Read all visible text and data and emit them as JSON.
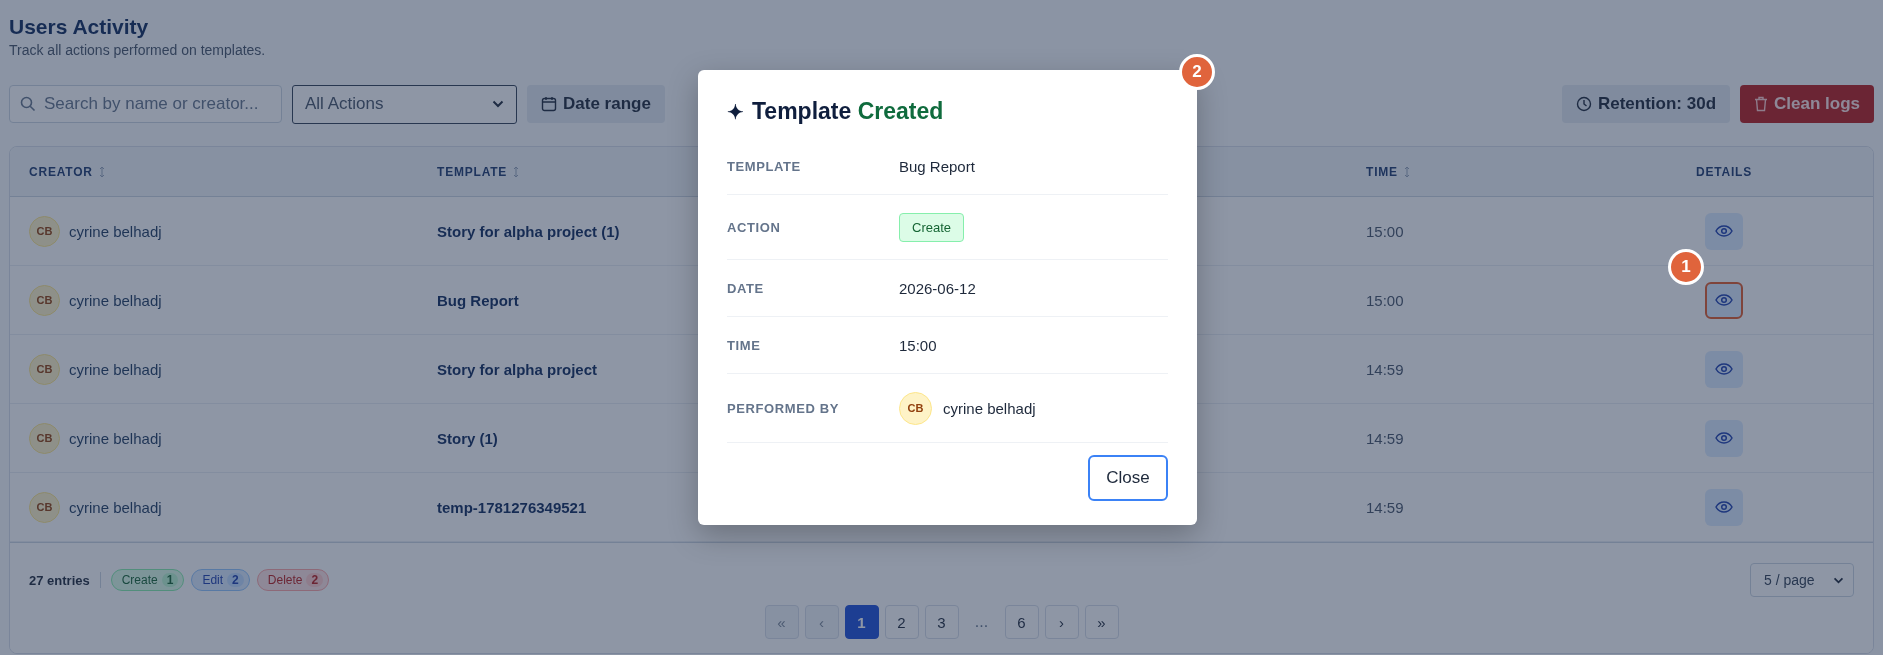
{
  "page": {
    "title": "Users Activity",
    "subtitle": "Track all actions performed on templates."
  },
  "toolbar": {
    "search_placeholder": "Search by name or creator...",
    "action_filter": "All Actions",
    "date_range": "Date range",
    "retention": "Retention: 30d",
    "clean_logs": "Clean logs"
  },
  "table": {
    "columns": [
      {
        "label": "CREATOR",
        "sortable": true
      },
      {
        "label": "TEMPLATE",
        "sortable": true
      },
      {
        "label": "TIME",
        "sortable": true
      },
      {
        "label": "DETAILS",
        "sortable": false
      }
    ],
    "rows": [
      {
        "initials": "CB",
        "creator": "cyrine belhadj",
        "template": "Story for alpha project (1)",
        "time": "15:00",
        "highlighted": false
      },
      {
        "initials": "CB",
        "creator": "cyrine belhadj",
        "template": "Bug Report",
        "time": "15:00",
        "highlighted": true
      },
      {
        "initials": "CB",
        "creator": "cyrine belhadj",
        "template": "Story for alpha project",
        "time": "14:59",
        "highlighted": false
      },
      {
        "initials": "CB",
        "creator": "cyrine belhadj",
        "template": "Story (1)",
        "time": "14:59",
        "highlighted": false
      },
      {
        "initials": "CB",
        "creator": "cyrine belhadj",
        "template": "temp-1781276349521",
        "time": "14:59",
        "highlighted": false
      }
    ]
  },
  "footer": {
    "entries": "27 entries",
    "counts": [
      {
        "label": "Create",
        "count": "1",
        "kind": "create"
      },
      {
        "label": "Edit",
        "count": "2",
        "kind": "edit"
      },
      {
        "label": "Delete",
        "count": "2",
        "kind": "delete"
      }
    ],
    "per_page": "5 / page",
    "pagination": [
      {
        "label": "«",
        "selected": false,
        "disabled": true
      },
      {
        "label": "‹",
        "selected": false,
        "disabled": true
      },
      {
        "label": "1",
        "selected": true,
        "disabled": false
      },
      {
        "label": "2",
        "selected": false,
        "disabled": false
      },
      {
        "label": "3",
        "selected": false,
        "disabled": false
      },
      {
        "label": "...",
        "kind": "gap"
      },
      {
        "label": "6",
        "selected": false,
        "disabled": false
      },
      {
        "label": "›",
        "selected": false,
        "disabled": false
      },
      {
        "label": "»",
        "selected": false,
        "disabled": false
      }
    ]
  },
  "modal": {
    "icon": "✦",
    "title": "Template",
    "status": "Created",
    "fields": [
      {
        "label": "TEMPLATE",
        "kind": "text",
        "value": "Bug Report"
      },
      {
        "label": "ACTION",
        "kind": "tag",
        "value": "Create"
      },
      {
        "label": "DATE",
        "kind": "text",
        "value": "2026-06-12"
      },
      {
        "label": "TIME",
        "kind": "text",
        "value": "15:00"
      },
      {
        "label": "PERFORMED BY",
        "kind": "user",
        "initials": "CB",
        "value": "cyrine belhadj"
      }
    ],
    "close": "Close"
  },
  "callouts": [
    {
      "number": "1"
    },
    {
      "number": "2"
    }
  ]
}
